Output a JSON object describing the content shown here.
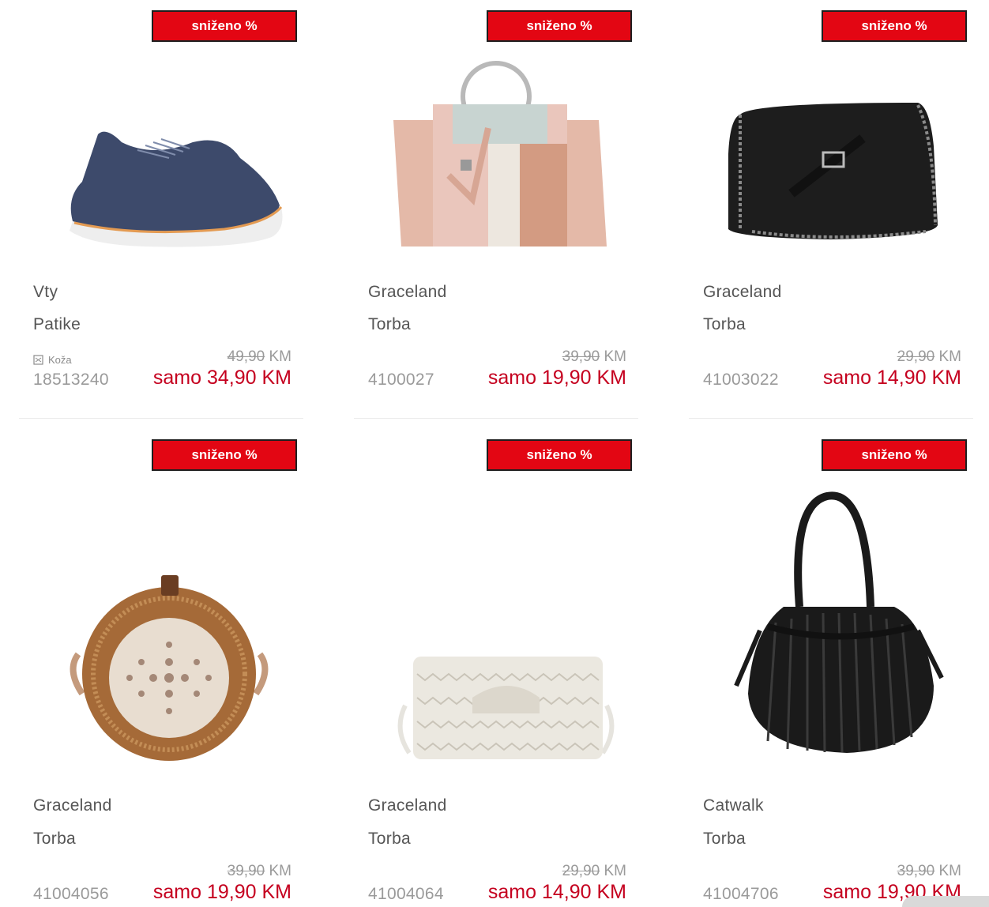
{
  "badge_label": "sniženo %",
  "currency": "KM",
  "price_prefix": "samo",
  "products": [
    {
      "brand": "Vty",
      "type": "Patike",
      "material": "Koža",
      "sku": "18513240",
      "old_price": "49,90",
      "new_price": "samo 34,90 KM",
      "image_icon": "sneaker-icon"
    },
    {
      "brand": "Graceland",
      "type": "Torba",
      "material": "",
      "sku": "4100027",
      "old_price": "39,90",
      "new_price": "samo 19,90 KM",
      "image_icon": "pink-handbag-icon"
    },
    {
      "brand": "Graceland",
      "type": "Torba",
      "material": "",
      "sku": "41003022",
      "old_price": "29,90",
      "new_price": "samo 14,90 KM",
      "image_icon": "black-chain-bag-icon"
    },
    {
      "brand": "Graceland",
      "type": "Torba",
      "material": "",
      "sku": "41004056",
      "old_price": "39,90",
      "new_price": "samo 19,90 KM",
      "image_icon": "round-rattan-bag-icon"
    },
    {
      "brand": "Graceland",
      "type": "Torba",
      "material": "",
      "sku": "41004064",
      "old_price": "29,90",
      "new_price": "samo 14,90 KM",
      "image_icon": "white-clutch-bag-icon"
    },
    {
      "brand": "Catwalk",
      "type": "Torba",
      "material": "",
      "sku": "41004706",
      "old_price": "39,90",
      "new_price": "samo 19,90 KM",
      "image_icon": "black-bucket-bag-icon"
    }
  ]
}
